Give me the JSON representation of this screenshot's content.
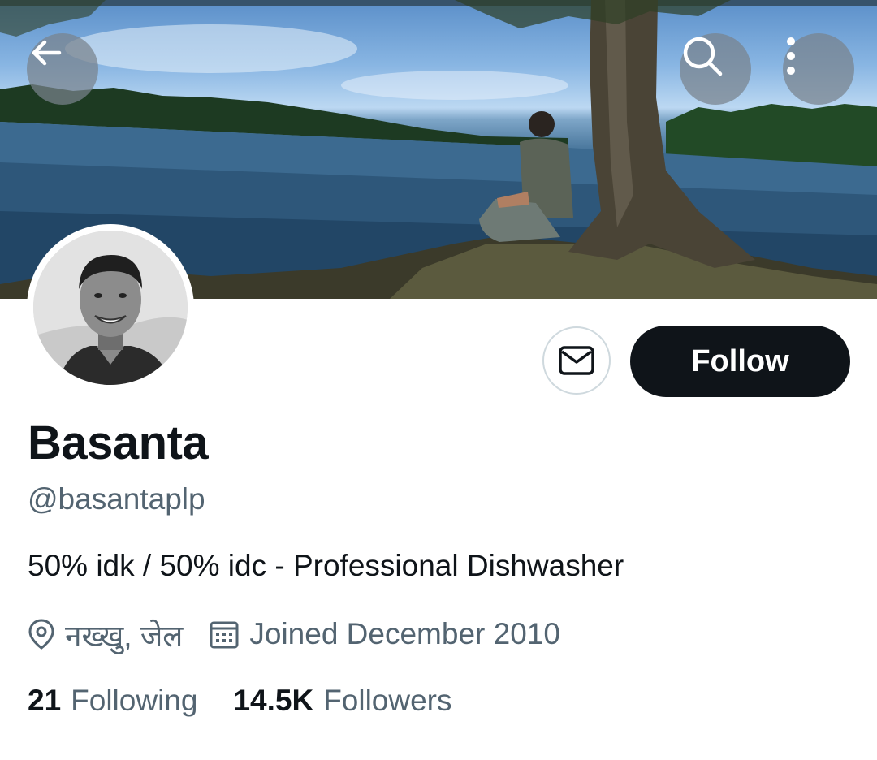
{
  "header": {
    "back_icon": "arrow-left-icon",
    "search_icon": "search-icon",
    "more_icon": "more-vertical-icon"
  },
  "profile": {
    "name": "Basanta",
    "handle": "@basantaplp",
    "bio": "50% idk / 50% idc - Professional Dishwasher",
    "location": "नख्खु, जेल",
    "joined": "Joined December 2010",
    "following_count": "21",
    "following_label": "Following",
    "followers_count": "14.5K",
    "followers_label": "Followers"
  },
  "actions": {
    "follow_label": "Follow",
    "message_icon": "envelope-icon"
  },
  "colors": {
    "text_primary": "#0f1419",
    "text_secondary": "#536471",
    "follow_bg": "#0f1419",
    "border": "#cfd9de"
  }
}
